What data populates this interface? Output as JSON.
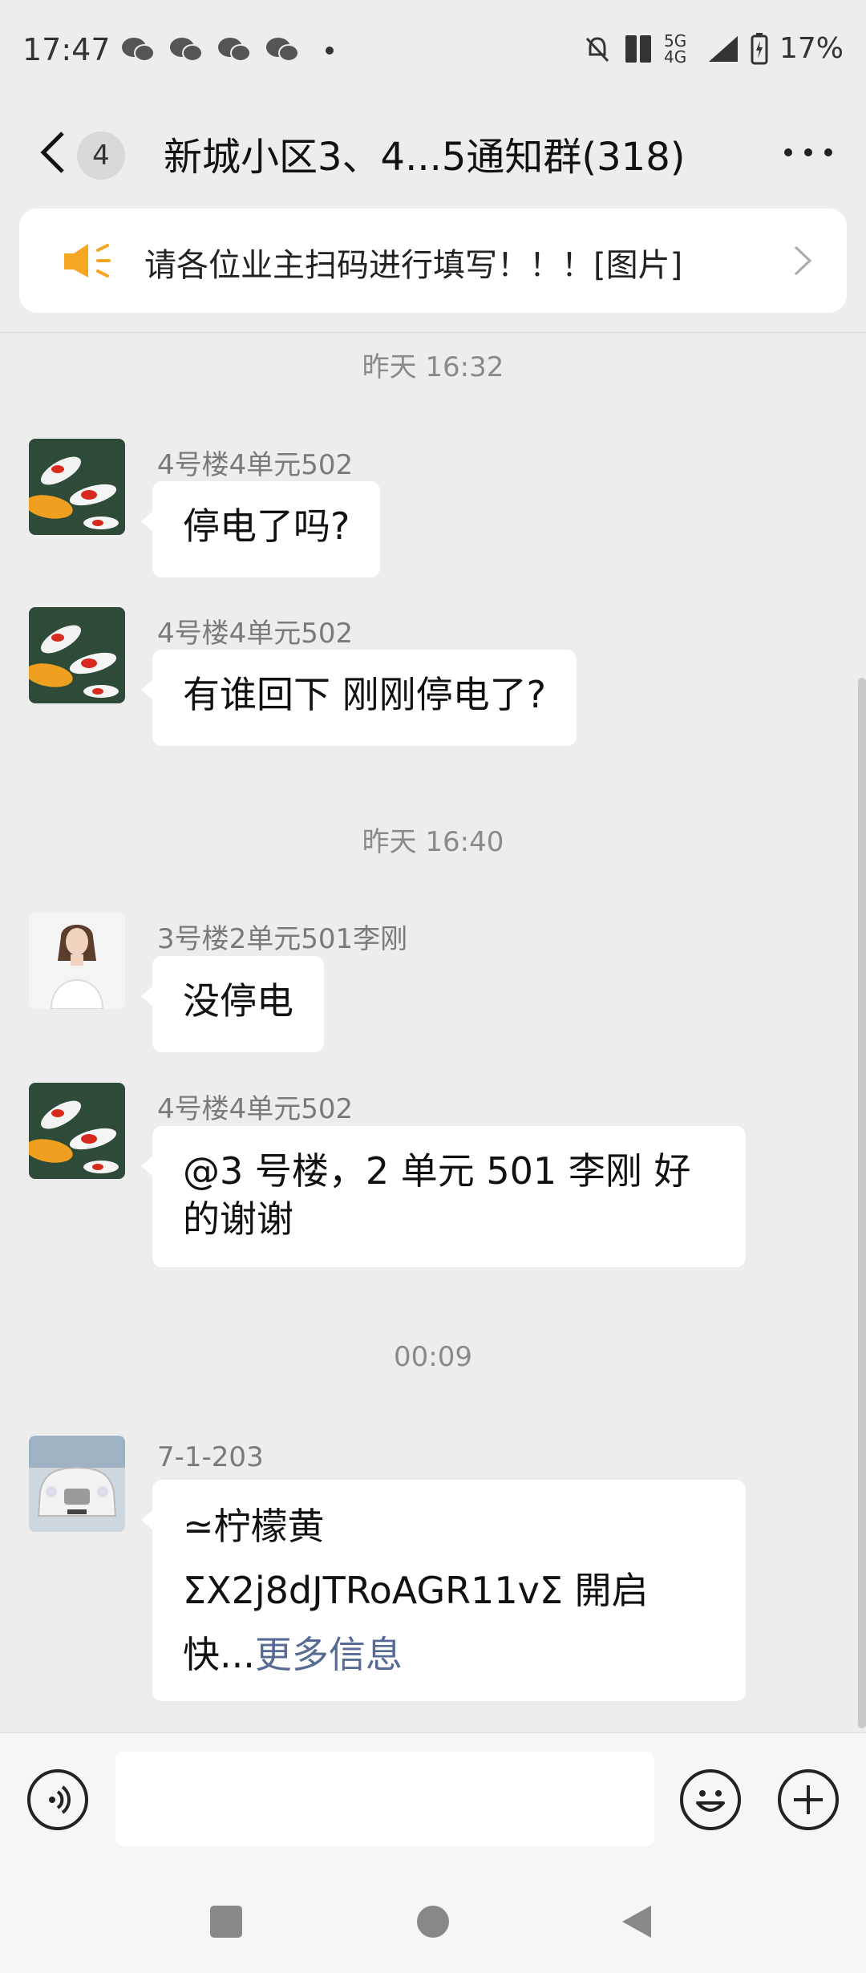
{
  "status_bar": {
    "time": "17:47",
    "network": "5G 4G",
    "battery": "17%"
  },
  "nav": {
    "back_count": "4",
    "title": "新城小区3、4...5通知群(318)"
  },
  "notice": {
    "text": "请各位业主扫码进行填写！！！[图片]"
  },
  "messages": [
    {
      "timestamp": "昨天 16:32"
    },
    {
      "sender": "4号楼4单元502",
      "text": "停电了吗?"
    },
    {
      "sender": "4号楼4单元502",
      "text": "有谁回下 刚刚停电了?"
    },
    {
      "timestamp": "昨天 16:40"
    },
    {
      "sender": "3号楼2单元501李刚",
      "text": "没停电"
    },
    {
      "sender": "4号楼4单元502",
      "text_line1": "@3 号楼，2 单元 501 李刚  好",
      "text_line2": "的谢谢"
    },
    {
      "timestamp": "00:09"
    },
    {
      "sender": "7-1-203",
      "line1": "≃柠檬黄",
      "line2": "ΣX2j8dJTRoAGR11vΣ 開启",
      "line3": "快...",
      "link": "更多信息"
    }
  ],
  "colors": {
    "background": "#ededed",
    "bubble": "#ffffff",
    "link": "#576b95",
    "notice_icon": "#f5a623"
  }
}
